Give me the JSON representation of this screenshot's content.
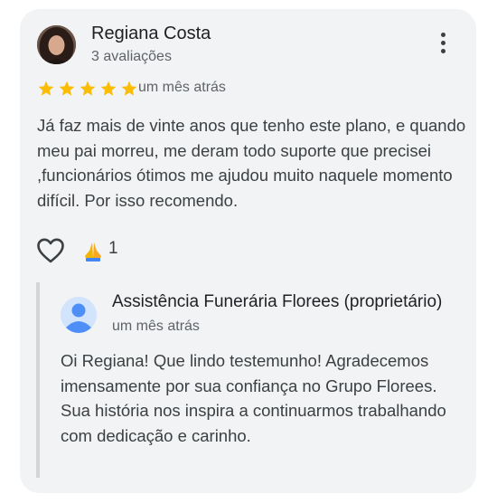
{
  "review": {
    "author": "Regiana Costa",
    "reviews_count": "3 avaliações",
    "rating": 5,
    "date": "um mês atrás",
    "text": "Já faz mais de vinte anos que tenho este plano, e quando meu pai morreu, me deram todo suporte que precisei ,funcionários ótimos me ajudou muito naquele momento difícil. Por isso recomendo.",
    "reaction_icon": "folded-hands-emoji",
    "reaction_count": "1"
  },
  "reply": {
    "owner": "Assistência Funerária Florees (proprietário)",
    "date": "um mês atrás",
    "text": "Oi Regiana! Que lindo testemunho! Agradecemos imensamente por sua confiança no Grupo Florees. Sua história nos inspira a continuarmos trabalhando com dedicação e carinho."
  },
  "colors": {
    "star": "#fbbc04",
    "card_bg": "#f1f3f4",
    "owner_avatar": "#4e8ef7"
  }
}
